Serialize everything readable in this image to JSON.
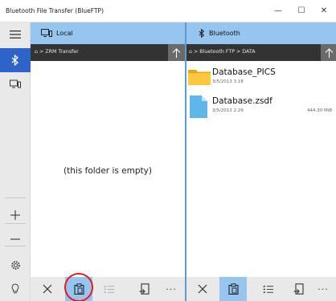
{
  "window": {
    "title": "Bluetooth File Transfer (BlueFTP)",
    "controls": {
      "minimize": "—",
      "maximize": "☐",
      "close": "✕"
    }
  },
  "rail": {
    "items": [
      {
        "icon": "hamburger-menu-icon",
        "active": false
      },
      {
        "icon": "bluetooth-icon",
        "active": true
      },
      {
        "icon": "computer-icon",
        "active": false
      },
      {
        "icon": "zoom-in-icon",
        "active": false
      },
      {
        "icon": "zoom-out-icon",
        "active": false
      },
      {
        "icon": "settings-icon",
        "active": false
      },
      {
        "icon": "lightbulb-icon",
        "active": false
      }
    ]
  },
  "local": {
    "header_label": "Local",
    "path": "⌂ > ZRM Transfer",
    "empty_message": "(this folder is empty)"
  },
  "remote": {
    "header_label": "Bluetooth",
    "path": "⌂ > Bluetooth FTP > DATA",
    "items": [
      {
        "name": "Database_PICS",
        "date": "3/5/2013 3:18",
        "size": "",
        "type": "folder"
      },
      {
        "name": "Database.zsdf",
        "date": "3/5/2013 2:29",
        "size": "444.30 MiB",
        "type": "file"
      }
    ]
  },
  "colors": {
    "accent": "#2e63c9",
    "header": "#96c6ef",
    "pathbar": "#333333",
    "divider": "#5b9bd5",
    "highlight": "#e41b1b"
  }
}
